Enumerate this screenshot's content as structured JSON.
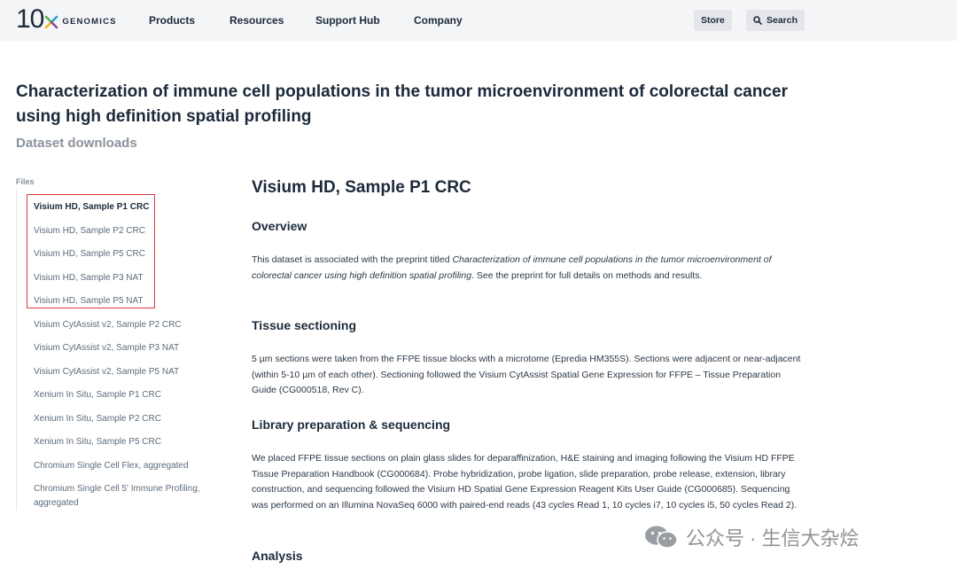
{
  "brand": {
    "logo_number": "10",
    "logo_word": "GENOMICS",
    "colors": {
      "green": "#4fb848",
      "blue": "#1aa3d8",
      "yellow": "#f2b51c",
      "purple": "#8c4a9e",
      "highlight": "#d9393a"
    }
  },
  "nav": {
    "items": [
      "Products",
      "Resources",
      "Support Hub",
      "Company"
    ],
    "store_label": "Store",
    "search_label": "Search"
  },
  "page": {
    "title": "Characterization of immune cell populations in the tumor microenvironment of colorectal cancer using high definition spatial profiling",
    "subtitle": "Dataset downloads"
  },
  "sidebar": {
    "label": "Files",
    "items": [
      "Visium HD, Sample P1 CRC",
      "Visium HD, Sample P2 CRC",
      "Visium HD, Sample P5 CRC",
      "Visium HD, Sample P3 NAT",
      "Visium HD, Sample P5 NAT",
      "Visium CytAssist v2, Sample P2 CRC",
      "Visium CytAssist v2, Sample P3 NAT",
      "Visium CytAssist v2, Sample P5 NAT",
      "Xenium In Situ, Sample P1 CRC",
      "Xenium In Situ, Sample P2 CRC",
      "Xenium In Situ, Sample P5 CRC",
      "Chromium Single Cell Flex, aggregated",
      "Chromium Single Cell 5' Immune Profiling, aggregated"
    ]
  },
  "content": {
    "heading": "Visium HD, Sample P1 CRC",
    "overview_heading": "Overview",
    "overview_pre": "This dataset is associated with the preprint titled ",
    "overview_italic": "Characterization of immune cell populations in the tumor microenvironment of colorectal cancer using high definition spatial profiling",
    "overview_post": ". See the preprint for full details on methods and results.",
    "tissue_heading": "Tissue sectioning",
    "tissue_text": "5 µm sections were taken from the FFPE tissue blocks with a microtome (Epredia HM355S). Sections were adjacent or near-adjacent (within 5-10 µm of each other). Sectioning followed the Visium CytAssist Spatial Gene Expression for FFPE – Tissue Preparation Guide (CG000518, Rev C).",
    "library_heading": "Library preparation & sequencing",
    "library_text": "We placed FFPE tissue sections on plain glass slides for deparaffinization, H&E staining and imaging following the Visium HD FFPE Tissue Preparation Handbook (CG000684). Probe hybridization, probe ligation, slide preparation, probe release, extension, library construction, and sequencing followed the Visium HD Spatial Gene Expression Reagent Kits User Guide (CG000685). Sequencing was performed on an Illumina NovaSeq 6000 with paired-end reads (43 cycles Read 1, 10 cycles i7, 10 cycles i5, 50 cycles Read 2).",
    "analysis_heading": "Analysis"
  },
  "watermark": {
    "text": "公众号 · 生信大杂烩"
  }
}
